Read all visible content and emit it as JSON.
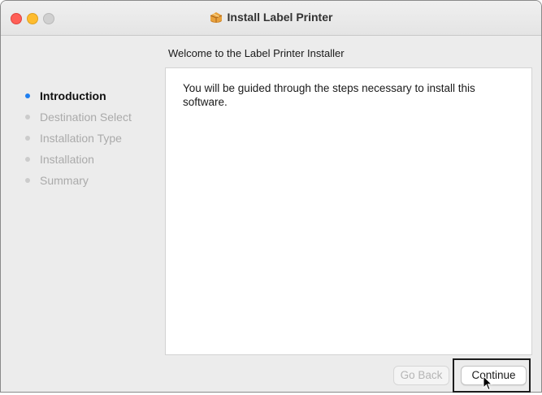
{
  "window": {
    "title": "Install Label Printer",
    "title_icon": "package-icon"
  },
  "header": {
    "subtitle": "Welcome to the Label Printer Installer"
  },
  "sidebar": {
    "steps": [
      {
        "label": "Introduction",
        "active": true
      },
      {
        "label": "Destination Select",
        "active": false
      },
      {
        "label": "Installation Type",
        "active": false
      },
      {
        "label": "Installation",
        "active": false
      },
      {
        "label": "Summary",
        "active": false
      }
    ]
  },
  "main": {
    "body": "You will be guided through the steps necessary to install this software."
  },
  "buttons": {
    "back_label": "Go Back",
    "back_enabled": false,
    "continue_label": "Continue"
  },
  "colors": {
    "accent": "#1f7ff0",
    "close": "#ff5f57",
    "minimize": "#febc2e",
    "zoom_inactive": "#d0d0d0"
  }
}
